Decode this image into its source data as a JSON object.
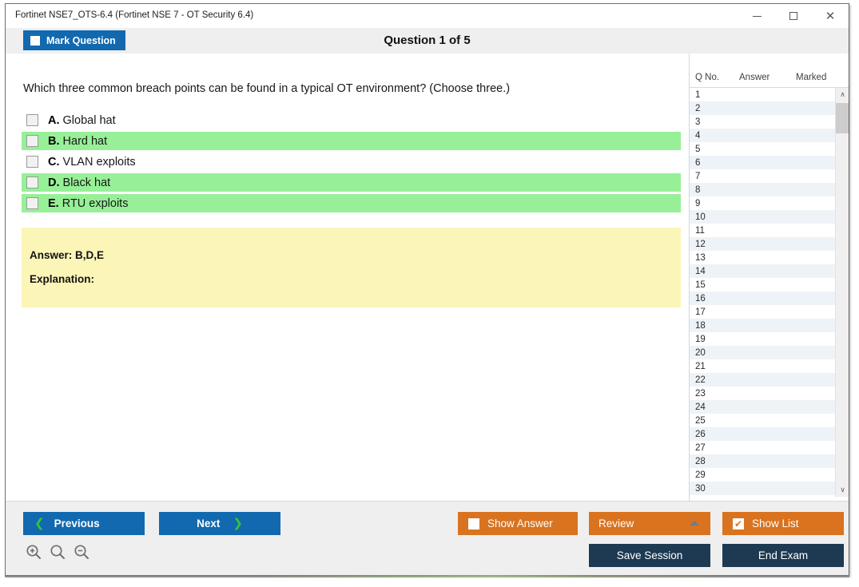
{
  "window": {
    "title": "Fortinet NSE7_OTS-6.4 (Fortinet NSE 7 - OT Security 6.4)",
    "minimize_label": "Minimize",
    "maximize_label": "Maximize",
    "close_label": "Close"
  },
  "header": {
    "mark_question_label": "Mark Question",
    "question_counter": "Question 1 of 5"
  },
  "question": {
    "text": "Which three common breach points can be found in a typical OT environment? (Choose three.)",
    "options": [
      {
        "letter": "A.",
        "text": "Global hat",
        "highlighted": false
      },
      {
        "letter": "B.",
        "text": "Hard hat",
        "highlighted": true
      },
      {
        "letter": "C.",
        "text": "VLAN exploits",
        "highlighted": false
      },
      {
        "letter": "D.",
        "text": "Black hat",
        "highlighted": true
      },
      {
        "letter": "E.",
        "text": "RTU exploits",
        "highlighted": true
      }
    ],
    "answer_label": "Answer: B,D,E",
    "explanation_label": "Explanation:"
  },
  "list_panel": {
    "columns": [
      "Q No.",
      "Answer",
      "Marked"
    ],
    "rows": [
      {
        "no": "1",
        "answer": "",
        "marked": ""
      },
      {
        "no": "2",
        "answer": "",
        "marked": ""
      },
      {
        "no": "3",
        "answer": "",
        "marked": ""
      },
      {
        "no": "4",
        "answer": "",
        "marked": ""
      },
      {
        "no": "5",
        "answer": "",
        "marked": ""
      },
      {
        "no": "6",
        "answer": "",
        "marked": ""
      },
      {
        "no": "7",
        "answer": "",
        "marked": ""
      },
      {
        "no": "8",
        "answer": "",
        "marked": ""
      },
      {
        "no": "9",
        "answer": "",
        "marked": ""
      },
      {
        "no": "10",
        "answer": "",
        "marked": ""
      },
      {
        "no": "11",
        "answer": "",
        "marked": ""
      },
      {
        "no": "12",
        "answer": "",
        "marked": ""
      },
      {
        "no": "13",
        "answer": "",
        "marked": ""
      },
      {
        "no": "14",
        "answer": "",
        "marked": ""
      },
      {
        "no": "15",
        "answer": "",
        "marked": ""
      },
      {
        "no": "16",
        "answer": "",
        "marked": ""
      },
      {
        "no": "17",
        "answer": "",
        "marked": ""
      },
      {
        "no": "18",
        "answer": "",
        "marked": ""
      },
      {
        "no": "19",
        "answer": "",
        "marked": ""
      },
      {
        "no": "20",
        "answer": "",
        "marked": ""
      },
      {
        "no": "21",
        "answer": "",
        "marked": ""
      },
      {
        "no": "22",
        "answer": "",
        "marked": ""
      },
      {
        "no": "23",
        "answer": "",
        "marked": ""
      },
      {
        "no": "24",
        "answer": "",
        "marked": ""
      },
      {
        "no": "25",
        "answer": "",
        "marked": ""
      },
      {
        "no": "26",
        "answer": "",
        "marked": ""
      },
      {
        "no": "27",
        "answer": "",
        "marked": ""
      },
      {
        "no": "28",
        "answer": "",
        "marked": ""
      },
      {
        "no": "29",
        "answer": "",
        "marked": ""
      },
      {
        "no": "30",
        "answer": "",
        "marked": ""
      }
    ],
    "scroll_up_glyph": "∧",
    "scroll_down_glyph": "∨"
  },
  "bottombar": {
    "previous_label": "Previous",
    "next_label": "Next",
    "previous_chevron": "❮",
    "next_chevron": "❯",
    "show_answer_label": "Show Answer",
    "show_answer_checked": false,
    "review_label": "Review",
    "show_list_label": "Show List",
    "show_list_checked": true,
    "show_list_check_glyph": "✔",
    "save_session_label": "Save Session",
    "end_exam_label": "End Exam",
    "zoom_in_label": "Zoom In",
    "zoom_reset_label": "Zoom Reset",
    "zoom_out_label": "Zoom Out"
  },
  "colors": {
    "accent_blue": "#1269b0",
    "accent_orange": "#d9731f",
    "navy": "#1d3a52",
    "highlight_green": "#97f097",
    "answer_yellow": "#fcf5b8"
  }
}
